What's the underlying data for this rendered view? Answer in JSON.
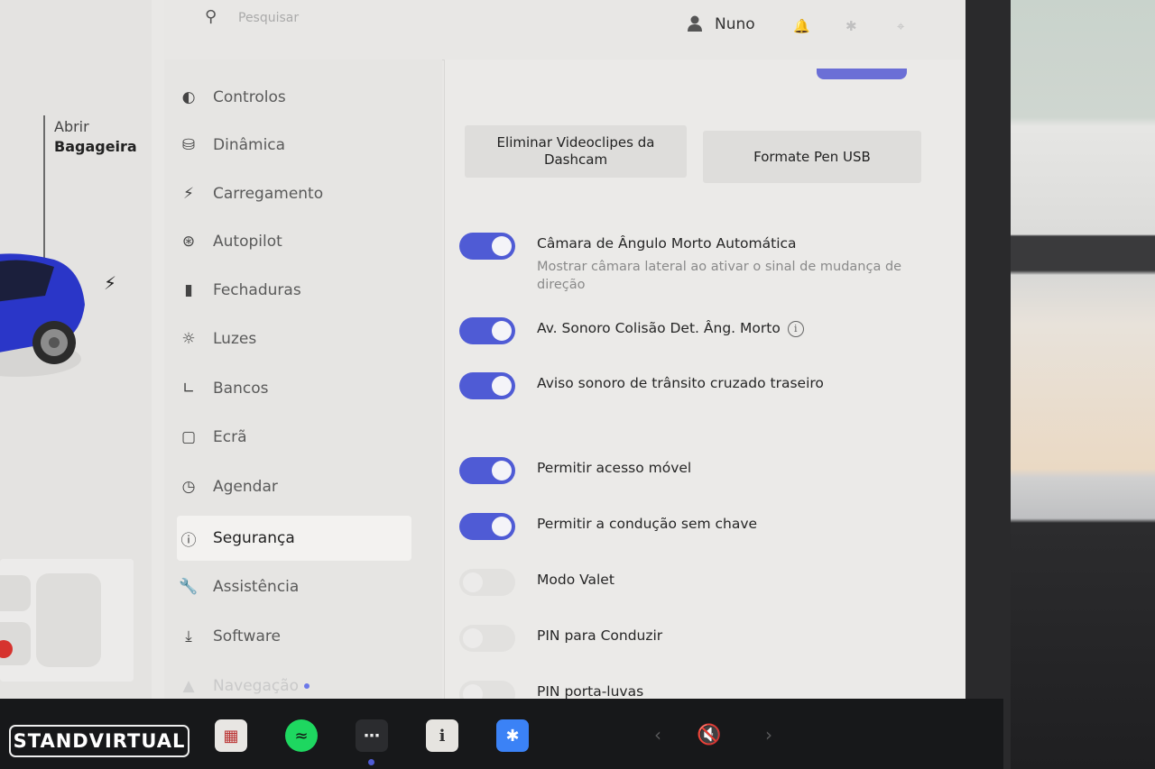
{
  "topbar": {
    "search_placeholder": "Pesquisar",
    "user_name": "Nuno"
  },
  "car_panel": {
    "trunk_line1": "Abrir",
    "trunk_line2": "Bagageira"
  },
  "sidebar": {
    "items": [
      {
        "label": "Controlos",
        "icon": "toggle-icon"
      },
      {
        "label": "Dinâmica",
        "icon": "car-icon"
      },
      {
        "label": "Carregamento",
        "icon": "bolt-icon"
      },
      {
        "label": "Autopilot",
        "icon": "steering-wheel-icon"
      },
      {
        "label": "Fechaduras",
        "icon": "lock-icon"
      },
      {
        "label": "Luzes",
        "icon": "light-icon"
      },
      {
        "label": "Bancos",
        "icon": "seat-icon"
      },
      {
        "label": "Ecrã",
        "icon": "display-icon"
      },
      {
        "label": "Agendar",
        "icon": "alarm-icon"
      },
      {
        "label": "Segurança",
        "icon": "alert-circle-icon",
        "active": true
      },
      {
        "label": "Assistência",
        "icon": "wrench-icon"
      },
      {
        "label": "Software",
        "icon": "download-icon"
      },
      {
        "label": "Navegação",
        "icon": "navigation-icon"
      }
    ]
  },
  "content": {
    "buttons": {
      "delete_dashcam": "Eliminar Videoclipes da Dashcam",
      "format_usb": "Formate Pen USB"
    },
    "settings": [
      {
        "label": "Câmara de Ângulo Morto Automática",
        "description": "Mostrar câmara lateral ao ativar o sinal de mudança de direção",
        "on": true
      },
      {
        "label": "Av. Sonoro Colisão Det. Âng. Morto",
        "on": true
      },
      {
        "label": "Aviso sonoro de trânsito cruzado traseiro",
        "on": true
      },
      {
        "label": "Permitir acesso móvel",
        "on": true
      },
      {
        "label": "Permitir a condução sem chave",
        "on": true
      },
      {
        "label": "Modo Valet",
        "on": false
      },
      {
        "label": "PIN para Conduzir",
        "on": false
      },
      {
        "label": "PIN porta-luvas",
        "on": false
      }
    ]
  },
  "dock": {
    "watermark": "STANDVIRTUAL",
    "apps": [
      "toybox-icon",
      "spotify-icon",
      "more-apps-icon",
      "manual-icon",
      "bluetooth-icon"
    ],
    "volume": "muted"
  },
  "colors": {
    "accent": "#4f5bd5",
    "screen_bg": "#e9e8e6"
  }
}
